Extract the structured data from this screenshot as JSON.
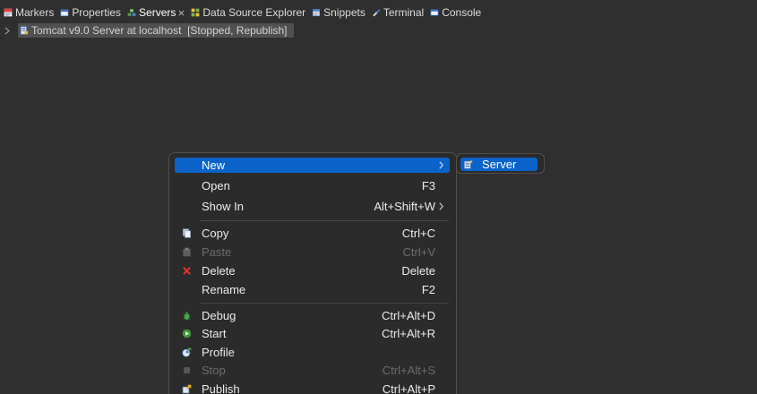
{
  "tabs": [
    {
      "label": "Markers",
      "icon": "markers-icon"
    },
    {
      "label": "Properties",
      "icon": "properties-icon"
    },
    {
      "label": "Servers",
      "icon": "servers-icon",
      "active": true,
      "closable": true
    },
    {
      "label": "Data Source Explorer",
      "icon": "data-source-explorer-icon"
    },
    {
      "label": "Snippets",
      "icon": "snippets-icon"
    },
    {
      "label": "Terminal",
      "icon": "terminal-icon"
    },
    {
      "label": "Console",
      "icon": "console-icon"
    }
  ],
  "servers_view": {
    "rows": [
      {
        "label": "Tomcat v9.0 Server at localhost  [Stopped, Republish]",
        "icon": "tomcat-server-icon",
        "expanded": false,
        "selected": true
      }
    ]
  },
  "context_menu": {
    "items": [
      {
        "label": "New",
        "selected": true,
        "has_submenu": true
      },
      {
        "label": "Open",
        "shortcut": "F3"
      },
      {
        "label": "Show In",
        "shortcut": "Alt+Shift+W",
        "has_submenu": true
      },
      {
        "label": "Copy",
        "shortcut": "Ctrl+C",
        "icon": "copy-icon"
      },
      {
        "label": "Paste",
        "shortcut": "Ctrl+V",
        "icon": "paste-icon",
        "enabled": false
      },
      {
        "label": "Delete",
        "shortcut": "Delete",
        "icon": "delete-icon"
      },
      {
        "label": "Rename",
        "shortcut": "F2"
      },
      {
        "label": "Debug",
        "shortcut": "Ctrl+Alt+D",
        "icon": "debug-icon"
      },
      {
        "label": "Start",
        "shortcut": "Ctrl+Alt+R",
        "icon": "start-icon"
      },
      {
        "label": "Profile",
        "icon": "profile-icon"
      },
      {
        "label": "Stop",
        "shortcut": "Ctrl+Alt+S",
        "icon": "stop-icon",
        "enabled": false
      },
      {
        "label": "Publish",
        "shortcut": "Ctrl+Alt+P",
        "icon": "publish-icon"
      }
    ]
  },
  "submenu_new": {
    "items": [
      {
        "label": "Server",
        "icon": "new-server-icon",
        "selected": true
      }
    ]
  },
  "colors": {
    "menu_selection": "#0b63c9",
    "tree_selection": "#505050",
    "background": "#2f2f2f",
    "menu_background": "#2b2b2b"
  }
}
